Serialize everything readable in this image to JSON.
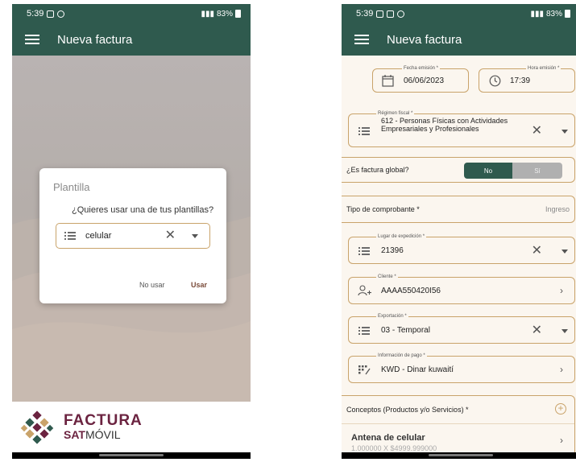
{
  "left": {
    "status": {
      "time": "5:39",
      "battery": "83%"
    },
    "appbar": {
      "title": "Nueva factura"
    },
    "dialog": {
      "title": "Plantilla",
      "message": "¿Quieres usar una de tus plantillas?",
      "select_value": "celular",
      "btn_no": "No usar",
      "btn_yes": "Usar"
    },
    "footer": {
      "logo_line1": "FACTURA",
      "logo_line2a": "SAT",
      "logo_line2b": "MÓVIL"
    }
  },
  "right": {
    "status": {
      "time": "5:39",
      "battery": "83%"
    },
    "appbar": {
      "title": "Nueva factura"
    },
    "fecha": {
      "label": "Fecha emisión *",
      "value": "06/06/2023"
    },
    "hora": {
      "label": "Hora emisión *",
      "value": "17:39"
    },
    "regimen": {
      "label": "Régimen fiscal *",
      "value": "612 - Personas Físicas con Actividades Empresariales y Profesionales"
    },
    "global": {
      "label": "¿Es factura global?",
      "no": "No",
      "si": "Sí"
    },
    "tipo": {
      "label": "Tipo de comprobante *",
      "value": "Ingreso"
    },
    "lugar": {
      "label": "Lugar de expedición *",
      "value": "21396"
    },
    "cliente": {
      "label": "Cliente *",
      "value": "AAAA550420I56"
    },
    "exportacion": {
      "label": "Exportación *",
      "value": "03 - Temporal"
    },
    "pago": {
      "label": "Información de pago *",
      "value": "KWD - Dinar kuwaití"
    },
    "conceptos": {
      "label": "Conceptos (Productos y/o Servicios) *"
    },
    "concepto_item": {
      "name": "Antena de celular",
      "detail": "1.000000 X $4999.999000"
    }
  },
  "colors": {
    "primary": "#2f5a4e",
    "accent": "#c9a36a",
    "brand": "#6b2340"
  }
}
